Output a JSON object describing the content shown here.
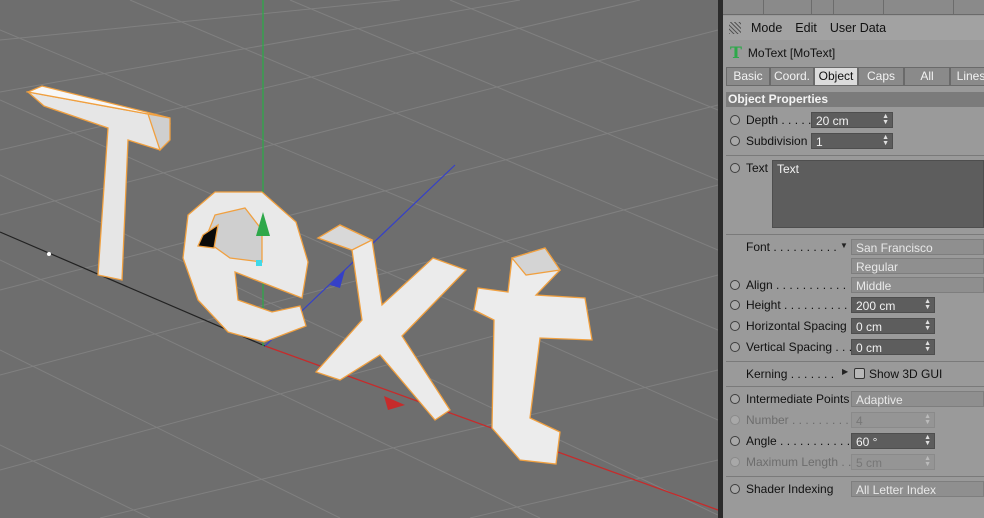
{
  "menubar": {
    "items": [
      "Mode",
      "Edit",
      "User Data"
    ]
  },
  "object": {
    "icon": "motext-icon",
    "name": "MoText [MoText]"
  },
  "tabs": [
    {
      "label": "Basic",
      "active": false
    },
    {
      "label": "Coord.",
      "active": false
    },
    {
      "label": "Object",
      "active": true
    },
    {
      "label": "Caps",
      "active": false
    },
    {
      "label": "All",
      "active": false
    },
    {
      "label": "Lines",
      "active": false
    }
  ],
  "section_title": "Object Properties",
  "props": {
    "depth": {
      "label": "Depth . . . . .",
      "value": "20 cm"
    },
    "subdivision": {
      "label": "Subdivision",
      "value": "1"
    },
    "text": {
      "label": "Text",
      "value": "Text"
    },
    "font": {
      "label": "Font . . . . . . . . . .",
      "value": "San Francisco",
      "style": "Regular"
    },
    "align": {
      "label": "Align . . . . . . . . . . .",
      "value": "Middle"
    },
    "height": {
      "label": "Height . . . . . . . . . . .",
      "value": "200 cm"
    },
    "hspacing": {
      "label": "Horizontal Spacing",
      "value": "0 cm"
    },
    "vspacing": {
      "label": "Vertical Spacing . . .",
      "value": "0 cm"
    },
    "kerning": {
      "label": "Kerning . . . . . . .",
      "show3d": "Show 3D GUI"
    },
    "intermediate": {
      "label": "Intermediate Points",
      "value": "Adaptive"
    },
    "number": {
      "label": "Number . . . . . . . . . .",
      "value": "4"
    },
    "angle": {
      "label": "Angle . . . . . . . . . . . .",
      "value": "60 °"
    },
    "maxlen": {
      "label": "Maximum Length . .",
      "value": "5 cm"
    },
    "shader": {
      "label": "Shader Indexing",
      "value": "All Letter Index"
    }
  },
  "colors": {
    "accent_green": "#2fa84b",
    "viewport_bg": "#6e6e6e",
    "panel_bg": "#9a9a9a",
    "selection_outline": "#f0a040"
  }
}
